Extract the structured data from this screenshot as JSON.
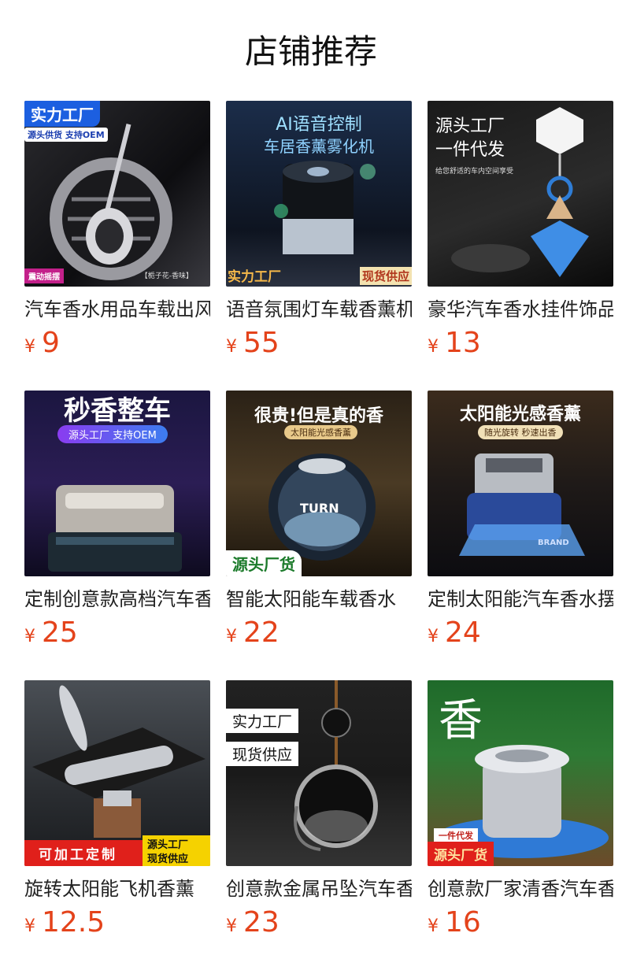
{
  "title": "店铺推荐",
  "currency": "¥",
  "products": [
    {
      "name": "汽车香水用品车载出风口香薰",
      "price": "9",
      "badges": [
        "实力工厂",
        "源头供货 支持OEM",
        "震动摇摆",
        "【栀子花-香味】"
      ]
    },
    {
      "name": "语音氛围灯车载香薰机",
      "price": "55",
      "badges": [
        "AI语音控制",
        "车居香薰雾化机",
        "实力工厂",
        "现货供应"
      ]
    },
    {
      "name": "豪华汽车香水挂件饰品",
      "price": "13",
      "badges": [
        "源头工厂",
        "一件代发",
        "给您舒适的车内空间享受"
      ]
    },
    {
      "name": "定制创意款高档汽车香水",
      "price": "25",
      "badges": [
        "秒香整车",
        "源头工厂 支持OEM"
      ]
    },
    {
      "name": "智能太阳能车载香水",
      "price": "22",
      "badges": [
        "很贵!但是真的香",
        "太阳能光感香薰",
        "源头厂货",
        "TURN"
      ]
    },
    {
      "name": "定制太阳能汽车香水摆件",
      "price": "24",
      "badges": [
        "太阳能光感香薰",
        "随光旋转 秒速出香",
        "BRAND"
      ]
    },
    {
      "name": "旋转太阳能飞机香薰",
      "price": "12.5",
      "badges": [
        "可加工定制",
        "源头工厂",
        "现货供应"
      ]
    },
    {
      "name": "创意款金属吊坠汽车香水",
      "price": "23",
      "badges": [
        "实力工厂",
        "现货供应"
      ]
    },
    {
      "name": "创意款厂家清香汽车香水",
      "price": "16",
      "badges": [
        "香",
        "一件代发",
        "源头厂货"
      ]
    }
  ]
}
